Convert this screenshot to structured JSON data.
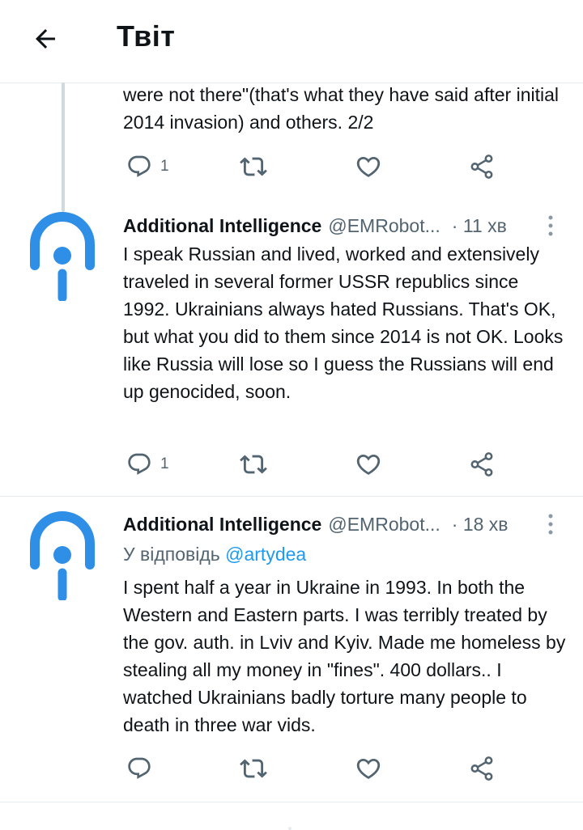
{
  "header": {
    "title": "Твіт",
    "back_icon": "arrow-left-icon"
  },
  "tweet0": {
    "text": "were not there\"(that's what they have said after initial 2014 invasion) and others. 2/2",
    "reply_count": "1"
  },
  "tweet1": {
    "name": "Additional Intelligence",
    "handle": "@EMRobot...",
    "time": "· 11 хв",
    "text": "I speak Russian and lived, worked and extensively traveled in several former USSR republics since 1992. Ukrainians always hated Russians. That's OK, but what you did to them since 2014 is not OK. Looks like Russia will lose so I guess the Russians will end up genocided, soon.",
    "reply_count": "1"
  },
  "tweet2": {
    "name": "Additional Intelligence",
    "handle": "@EMRobot...",
    "time": "· 18 хв",
    "reply_to_prefix": "У відповідь",
    "reply_to_user": "@artydea",
    "text": "I spent half a year in Ukraine in 1993. In both the Western and Eastern parts. I was terribly treated by the gov. auth. in Lviv and Kyiv. Made me homeless by stealing all my money in \"fines\". 400 dollars.. I watched Ukrainians badly torture many people to death in three war vids.",
    "reply_count": ""
  },
  "colors": {
    "text": "#0f1419",
    "secondary": "#536471",
    "accent": "#1d9bf0",
    "avatar": "#2f8fe6",
    "divider": "#e6ecf0"
  },
  "icons": {
    "reply": "reply-bubble-icon",
    "retweet": "retweet-icon",
    "like": "heart-icon",
    "share": "share-icon",
    "more": "more-vertical-icon"
  }
}
